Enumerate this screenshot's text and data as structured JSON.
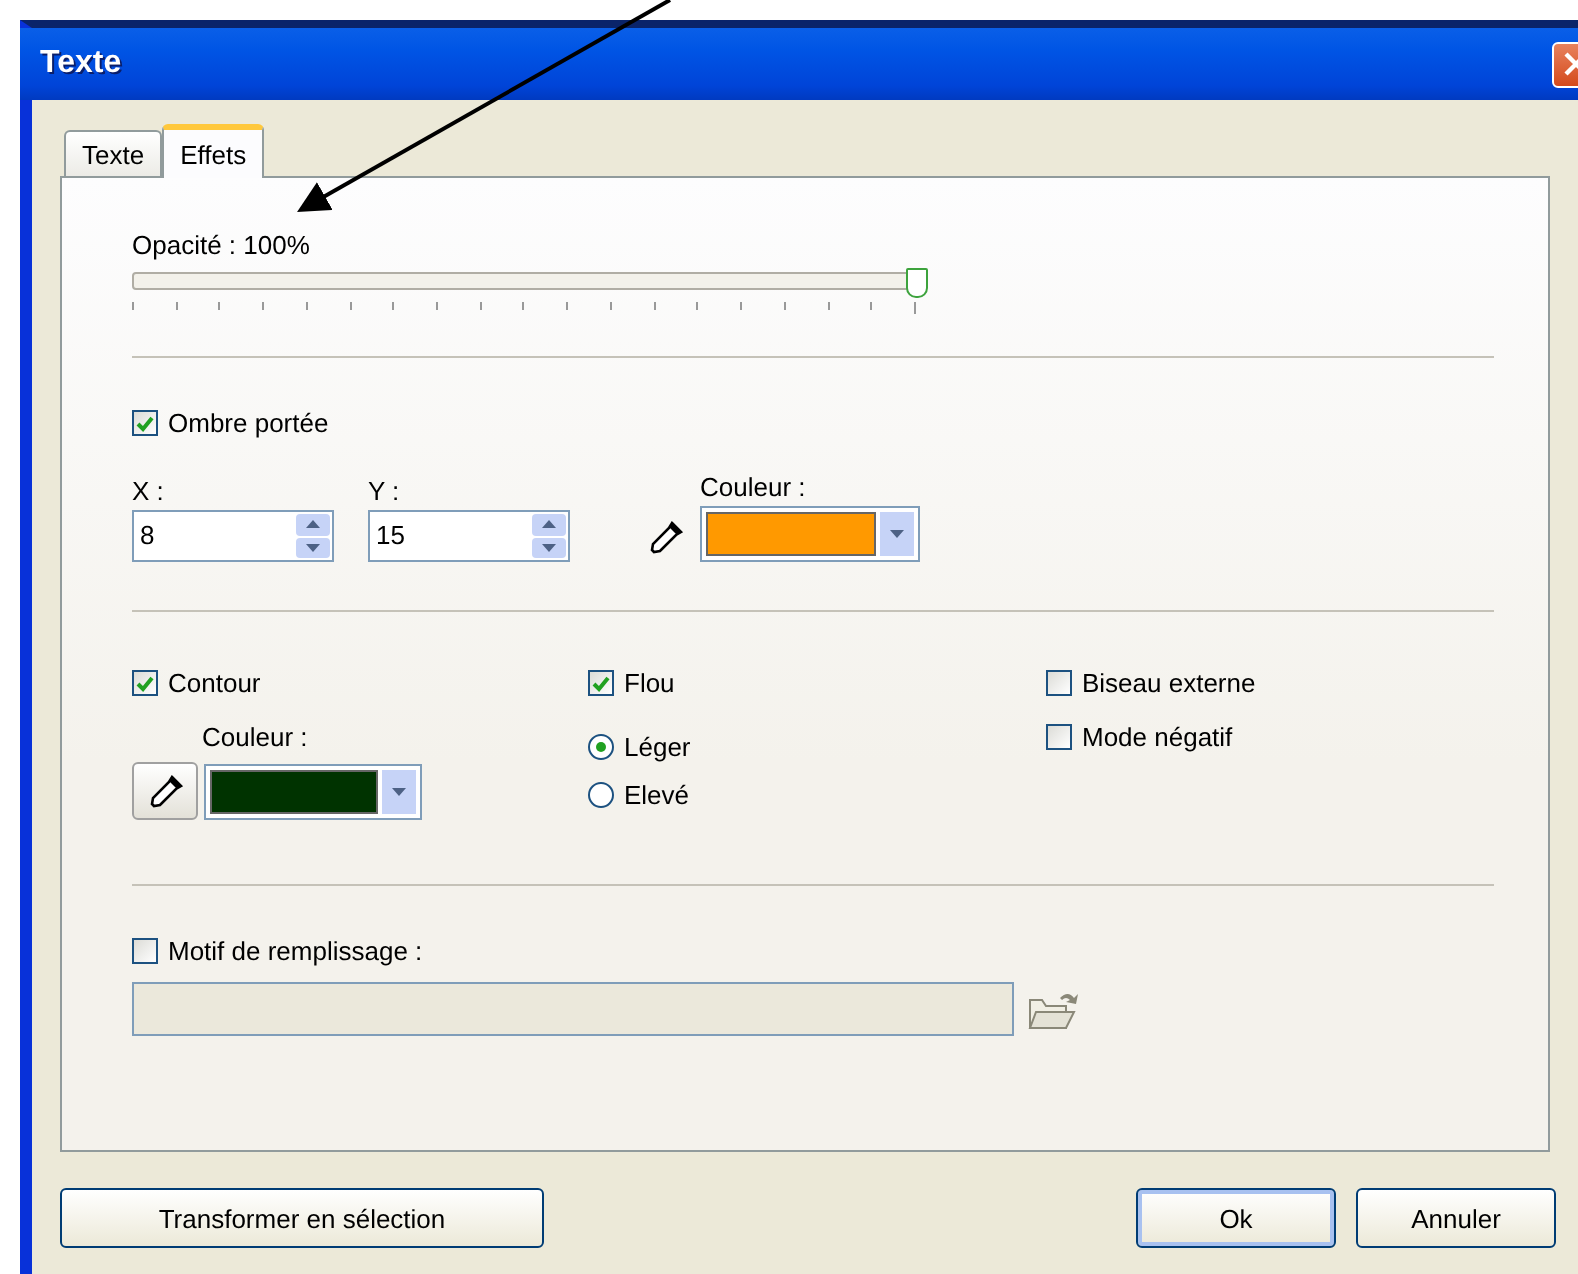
{
  "window": {
    "title": "Texte"
  },
  "tabs": [
    {
      "label": "Texte",
      "selected": false
    },
    {
      "label": "Effets",
      "selected": true
    }
  ],
  "opacity": {
    "label": "Opacité : 100%",
    "level": 1
  },
  "drop_shadow": {
    "label": "Ombre portée",
    "checked": true,
    "x": {
      "label": "X :",
      "value": "8"
    },
    "y": {
      "label": "Y :",
      "value": "15"
    },
    "color": {
      "label": "Couleur :",
      "color": "#ff9900"
    }
  },
  "contour": {
    "label": "Contour",
    "checked": true,
    "color": {
      "label": "Couleur :",
      "color": "#003300"
    }
  },
  "blur": {
    "label": "Flou",
    "checked": true,
    "options": [
      {
        "label": "Léger",
        "selected": true
      },
      {
        "label": "Elevé",
        "selected": false
      }
    ]
  },
  "options": [
    {
      "label": "Biseau externe",
      "checked": false
    },
    {
      "label": "Mode négatif",
      "checked": false
    }
  ],
  "fill_pattern": {
    "label": "Motif de remplissage :",
    "checked": false
  },
  "buttons": [
    {
      "label": "Transformer en sélection",
      "kind": "secondary"
    },
    {
      "label": "Ok",
      "kind": "default"
    },
    {
      "label": "Annuler",
      "kind": "normal"
    }
  ]
}
